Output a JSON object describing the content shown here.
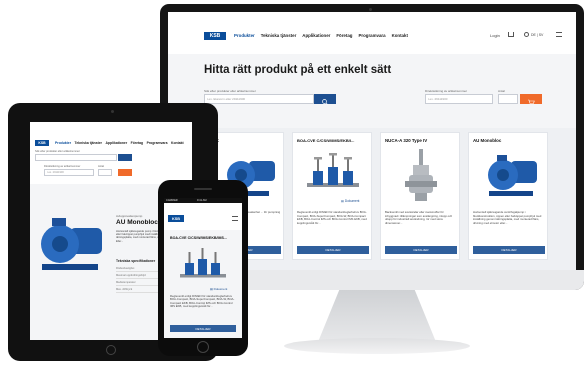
{
  "monitor": {
    "logo": "KSB",
    "nav": [
      "Produkter",
      "Tekniska tjänster",
      "Applikationer",
      "Företag",
      "Programvara",
      "Kontakt"
    ],
    "login": "Login",
    "lang": "DE | SV",
    "heading": "Hitta rätt produkt på ett enkelt sätt",
    "search_label": "Sök efter produkter eller artikelnummer",
    "search_placeholder": "t.ex. Etanorm eller 29111900",
    "config_label": "Direktsökning av artikelnummer",
    "config_placeholder": "t.ex. 29111900",
    "qty_label": "Antal",
    "cards": [
      {
        "title": "MDX",
        "desc": "... ssmaskinpump ... ning med maskerhet ... för pumpning ... kt ämnen som innehåller",
        "button": "DETALJER"
      },
      {
        "title": "BOA-CVE C/CS/W/IMS/EKB/I...",
        "desc": "Regleventil enligt DIN/EN för standardreglerbehov BOA-Compact, BOA-SuperCompact, BOA-W, BOA-Compact EKB, BOA-Control IMS och BOA-Control IMS EKB, med kopplingsmått för...",
        "doc": "Dokument",
        "button": "DETALJER"
      },
      {
        "title": "NUCA-A 320 Type IV",
        "desc": "Backventil med svetsändar eller svetsmuffar för inbyggnad i tillämpningar som avstängning, inlopp och utlopp för industriell användning, rör med stora dimensioner...",
        "button": "DETALJER"
      },
      {
        "title": "AU Monobloc",
        "desc": "Horisontell självsugande centrifugalpump i blockkonstruktion, öppen eller halvöppet pumphjul med inställning genom tätningsplatta, med monterad fläns, drivning med elmotor eller...",
        "button": "DETALJER"
      }
    ]
  },
  "tablet": {
    "logo": "KSB",
    "nav": [
      "Produkter",
      "Tekniska tjänster",
      "Applikationer",
      "Företag",
      "Programvara",
      "Kontakt"
    ],
    "search_label": "Sök efter produkter eller artikelnummer",
    "config_label": "Direktsökning av artikelnummer",
    "qty_label": "Antal",
    "config_placeholder": "t.ex. 29111900",
    "product_type": "Avloppsvattenpump",
    "product_title": "AU Monobloc",
    "product_desc": "Horisontell självsugande pump i blockkonstruktion, öppet eller halvöppet pumphjul med inställning genom tätningsplatta, med monterad fläns, drivning med elmotor. Eller...",
    "spec_heading": "Tekniska specifikationer",
    "spec_rows": [
      "Flödeshastighet",
      "Maximal uppfordringshöjd",
      "Medietemperatur",
      "Max. drifttryck"
    ]
  },
  "phone": {
    "status_left": "CARRIER",
    "status_time": "9:41 AM",
    "logo": "KSB",
    "card_title": "BOA-CVE C/CS/W/IMS/EKB/IMS...",
    "doc": "Dokument",
    "desc": "Regleventil enligt DIN/EN för standardreglerbehov BOA-Compact, BOA-SuperCompact, BOA-W, BOA-Compact EKB, BOA-Control IMS och BOA-Control IMS EKB, med kopplingsmått för...",
    "button": "DETALJER"
  },
  "colors": {
    "brand": "#0a4d9a",
    "accent": "#f06a2a",
    "button": "#2f5f9c"
  }
}
